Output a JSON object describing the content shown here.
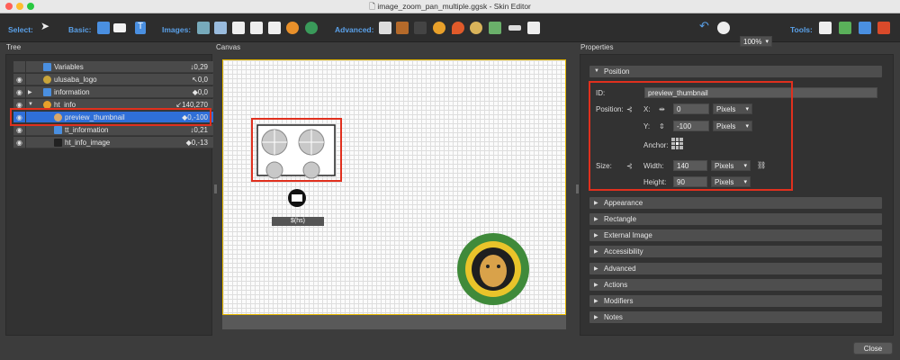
{
  "window": {
    "title": "image_zoom_pan_multiple.ggsk - Skin Editor"
  },
  "toolbar": {
    "select_label": "Select:",
    "basic_label": "Basic:",
    "images_label": "Images:",
    "advanced_label": "Advanced:",
    "tools_label": "Tools:",
    "zoom_value": "100%"
  },
  "tree": {
    "header": "Tree",
    "rows": [
      {
        "label": "Variables",
        "value": "↓0,29"
      },
      {
        "label": "ulusaba_logo",
        "value": "↖0,0"
      },
      {
        "label": "information",
        "value": "◆0,0"
      },
      {
        "label": "ht_info",
        "value": "↙140,270"
      },
      {
        "label": "preview_thumbnail",
        "value": "◆0,-100"
      },
      {
        "label": "tt_information",
        "value": "↓0,21"
      },
      {
        "label": "ht_info_image",
        "value": "◆0,-13"
      }
    ]
  },
  "canvas": {
    "header": "Canvas",
    "hotspot_label": "$(hs)"
  },
  "properties": {
    "header": "Properties",
    "position_section": "Position",
    "id_label": "ID:",
    "id_value": "preview_thumbnail",
    "position_label": "Position:",
    "x_label": "X:",
    "x_value": "0",
    "y_label": "Y:",
    "y_value": "-100",
    "unit": "Pixels",
    "anchor_label": "Anchor:",
    "size_label": "Size:",
    "width_label": "Width:",
    "width_value": "140",
    "height_label": "Height:",
    "height_value": "90",
    "sections": [
      "Appearance",
      "Rectangle",
      "External Image",
      "Accessibility",
      "Advanced",
      "Actions",
      "Modifiers",
      "Notes"
    ]
  },
  "footer": {
    "close_label": "Close"
  },
  "colors": {
    "accent": "#5aa0e8",
    "highlight": "#e0301e",
    "selection": "#2f6fd8"
  }
}
